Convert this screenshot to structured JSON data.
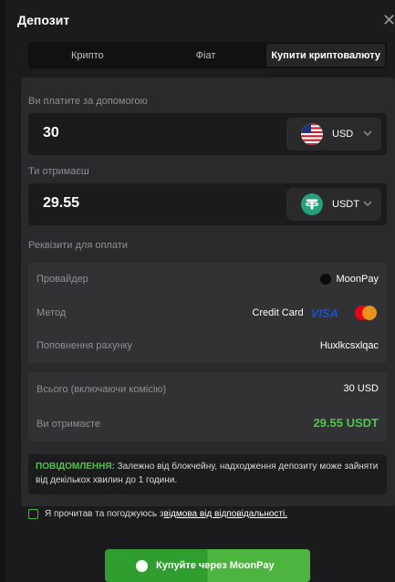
{
  "modal": {
    "title": "Депозит"
  },
  "tabs": [
    "Крипто",
    "Фіат",
    "Купити криптовалюту"
  ],
  "pay": {
    "label": "Ви платите за допомогою",
    "amount": "30",
    "currency": "USD"
  },
  "receive": {
    "label": "Ти отримаєш",
    "amount": "29.55",
    "currency": "USDT"
  },
  "payment_details": {
    "heading": "Реквізити для оплати",
    "provider_label": "Провайдер",
    "provider_value": "MoonPay",
    "method_label": "Метод",
    "method_value": "Credit Card",
    "visa_text": "VISA",
    "account_label": "Поповнення рахунку",
    "account_value": "Huxlkcsxlqac"
  },
  "totals": {
    "total_label": "Всього (включаючи комісію)",
    "total_value": "30 USD",
    "receive_label": "Ви отримаєте",
    "receive_value": "29.55 USDT"
  },
  "notice": {
    "prefix": "ПОВІДОМЛЕННЯ:",
    "text": " Залежно від блокчейну, надходження депозиту може зайняти від декількох хвилин до 1 години."
  },
  "agreement": {
    "text": "Я прочитав та погоджуюсь з ",
    "link": "відмова від відповідальності."
  },
  "buy_button": {
    "label": "Купуйте через MoonPay"
  },
  "colors": {
    "accent_green": "#4ec34b",
    "button_green": "#2f9e2f",
    "tether_green": "#26a17b",
    "visa_blue": "#1a4fd6"
  },
  "icons": [
    "close-icon",
    "us-flag-icon",
    "chevron-down-icon",
    "tether-icon",
    "moonpay-icon",
    "visa-logo",
    "mastercard-logo"
  ]
}
